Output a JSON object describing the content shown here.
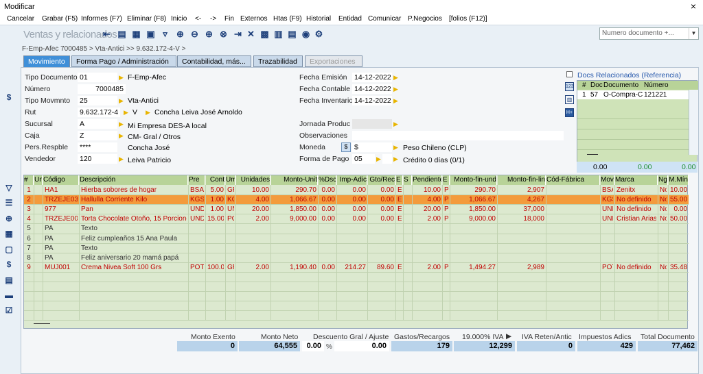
{
  "window": {
    "title": "Modificar",
    "close": "×"
  },
  "menu": [
    "Cancelar",
    "Grabar (F5)",
    "Informes (F7)",
    "Eliminar (F8)",
    "Inicio",
    "<-",
    "->",
    "Fin",
    "Externos",
    "Htas (F9)",
    "Historial",
    "Entidad",
    "Comunicar",
    "P.Negocios",
    "[folios (F12)]"
  ],
  "toolbar": {
    "title": "Ventas y relacionados",
    "search_placeholder": "Numero documento +..."
  },
  "breadcrumb": "F-Emp-Afec 7000485 > Vta-Antici >> 9.632.172-4-V >",
  "tabs": [
    "Movimiento",
    "Forma Pago / Administración",
    "Contabilidad, más...",
    "Trazabilidad",
    "Exportaciones"
  ],
  "form": {
    "tipo_documento": {
      "label": "Tipo Documento",
      "value": "01",
      "desc": "F-Emp-Afec"
    },
    "numero": {
      "label": "Número",
      "value": "7000485"
    },
    "tipo_movimiento": {
      "label": "Tipo Movmnto",
      "value": "25",
      "desc": "Vta-Antici"
    },
    "rut": {
      "label": "Rut",
      "value": "9.632.172-4",
      "dv": "V",
      "desc": "Concha Leiva José Arnoldo"
    },
    "sucursal": {
      "label": "Sucursal",
      "value": "A",
      "desc": "Mi Empresa DES-A local"
    },
    "caja": {
      "label": "Caja",
      "value": "Z",
      "desc": "CM- Gral / Otros"
    },
    "responsable": {
      "label": "Pers.Respble",
      "value": "****",
      "desc": "Concha José"
    },
    "vendedor": {
      "label": "Vendedor",
      "value": "120",
      "desc": "Leiva Patricio"
    },
    "fecha_emision": {
      "label": "Fecha Emisión",
      "value": "14-12-2022"
    },
    "fecha_contable": {
      "label": "Fecha Contable",
      "value": "14-12-2022"
    },
    "fecha_inventario": {
      "label": "Fecha Inventario",
      "value": "14-12-2022"
    },
    "jornada": {
      "label": "Jornada Produc"
    },
    "observaciones": {
      "label": "Observaciones"
    },
    "moneda": {
      "label": "Moneda",
      "value": "$",
      "desc": "Peso Chileno (CLP)"
    },
    "forma_pago": {
      "label": "Forma de Pago",
      "value": "05",
      "desc": "Crédito 0 días (0/1)"
    }
  },
  "related": {
    "title": "Docs Relacionados (Referencia)",
    "headers": [
      "#",
      "Doc",
      "Documento",
      "Número"
    ],
    "rows": [
      [
        "1",
        "57",
        "O-Compra-C",
        "121221"
      ]
    ],
    "totals": [
      "0.00",
      "0.00",
      "0.00"
    ]
  },
  "grid": {
    "headers": [
      "#",
      "Un",
      "Código",
      "Descripción",
      "Pre",
      "Cont",
      "Um",
      "Unidades",
      "Monto-Unit",
      "%Dsc",
      "Imp-Adic",
      "Gto/Rec",
      "E",
      "S",
      "Pendiente",
      "E",
      "Monto-fin-und",
      "Monto-fin-lin",
      "Cód-Fábrica",
      "Mov",
      "Marca",
      "Ng",
      "M.Mín"
    ],
    "rows": [
      {
        "style": "red",
        "cells": [
          "1",
          "",
          "HA1",
          "Hierba sobores de hogar",
          "BSA",
          "5.00",
          "GR",
          "10.00",
          "290.70",
          "0.00",
          "0.00",
          "0.00",
          "E",
          "",
          "10.00",
          "P",
          "290.70",
          "2,907",
          "",
          "BSA",
          "Zenitx",
          "No",
          "10.00"
        ]
      },
      {
        "style": "sel",
        "cells": [
          "2",
          "",
          "TRZEJE03",
          "Hallulla Corriente Kilo",
          "KGS",
          "1.00",
          "KG",
          "4.00",
          "1,066.67",
          "0.00",
          "0.00",
          "0.00",
          "E",
          "",
          "4.00",
          "P",
          "1,066.67",
          "4,267",
          "",
          "KGS",
          "No definido",
          "No",
          "55.00"
        ]
      },
      {
        "style": "red",
        "cells": [
          "3",
          "",
          "977",
          "Pan",
          "UND",
          "1.00",
          "UN",
          "20.00",
          "1,850.00",
          "0.00",
          "0.00",
          "0.00",
          "E",
          "",
          "20.00",
          "P",
          "1,850.00",
          "37,000",
          "",
          "UND",
          "No definido",
          "No",
          "0.00"
        ]
      },
      {
        "style": "red",
        "cells": [
          "4",
          "",
          "TRZEJE00",
          "Torta Chocolate Otoño, 15 Porciones",
          "UND",
          "15.00",
          "PC",
          "2.00",
          "9,000.00",
          "0.00",
          "0.00",
          "0.00",
          "E",
          "",
          "2.00",
          "P",
          "9,000.00",
          "18,000",
          "",
          "UND",
          "Cristian Arias",
          "No",
          "50.00"
        ]
      },
      {
        "style": "txt",
        "cells": [
          "5",
          "",
          "PA",
          "Texto",
          "",
          "",
          "",
          "",
          "",
          "",
          "",
          "",
          "",
          "",
          "",
          "",
          "",
          "",
          "",
          "",
          "",
          "",
          ""
        ]
      },
      {
        "style": "txt",
        "cells": [
          "6",
          "",
          "PA",
          "Feliz cumpleaños 15 Ana Paula",
          "",
          "",
          "",
          "",
          "",
          "",
          "",
          "",
          "",
          "",
          "",
          "",
          "",
          "",
          "",
          "",
          "",
          "",
          ""
        ]
      },
      {
        "style": "txt",
        "cells": [
          "7",
          "",
          "PA",
          "Texto",
          "",
          "",
          "",
          "",
          "",
          "",
          "",
          "",
          "",
          "",
          "",
          "",
          "",
          "",
          "",
          "",
          "",
          "",
          ""
        ]
      },
      {
        "style": "txt",
        "cells": [
          "8",
          "",
          "PA",
          "Feliz aniversario 20 mamá  papá",
          "",
          "",
          "",
          "",
          "",
          "",
          "",
          "",
          "",
          "",
          "",
          "",
          "",
          "",
          "",
          "",
          "",
          "",
          ""
        ]
      },
      {
        "style": "red",
        "cells": [
          "9",
          "",
          "MUJ001",
          "Crema Nivea Soft 100 Grs",
          "POT",
          "100.00",
          "GR",
          "2.00",
          "1,190.40",
          "0.00",
          "214.27",
          "89.60",
          "E",
          "",
          "2.00",
          "P",
          "1,494.27",
          "2,989",
          "",
          "POT",
          "No definido",
          "No",
          "35.48"
        ]
      }
    ]
  },
  "totals": {
    "labels": [
      "Monto Exento",
      "Monto Neto",
      "Descuento Gral / Ajuste",
      "Gastos/Recargos",
      "19.000% IVA",
      "IVA Reten/Antic",
      "Impuestos Adics",
      "Total Documento"
    ],
    "exento": "0",
    "neto": "64,555",
    "descuento_pct": "0.00",
    "descuento_pct_unit": "%",
    "descuento": "0.00",
    "gastos": "179",
    "iva": "12,299",
    "iva_reten": "0",
    "impuestos": "429",
    "total": "77,462"
  }
}
